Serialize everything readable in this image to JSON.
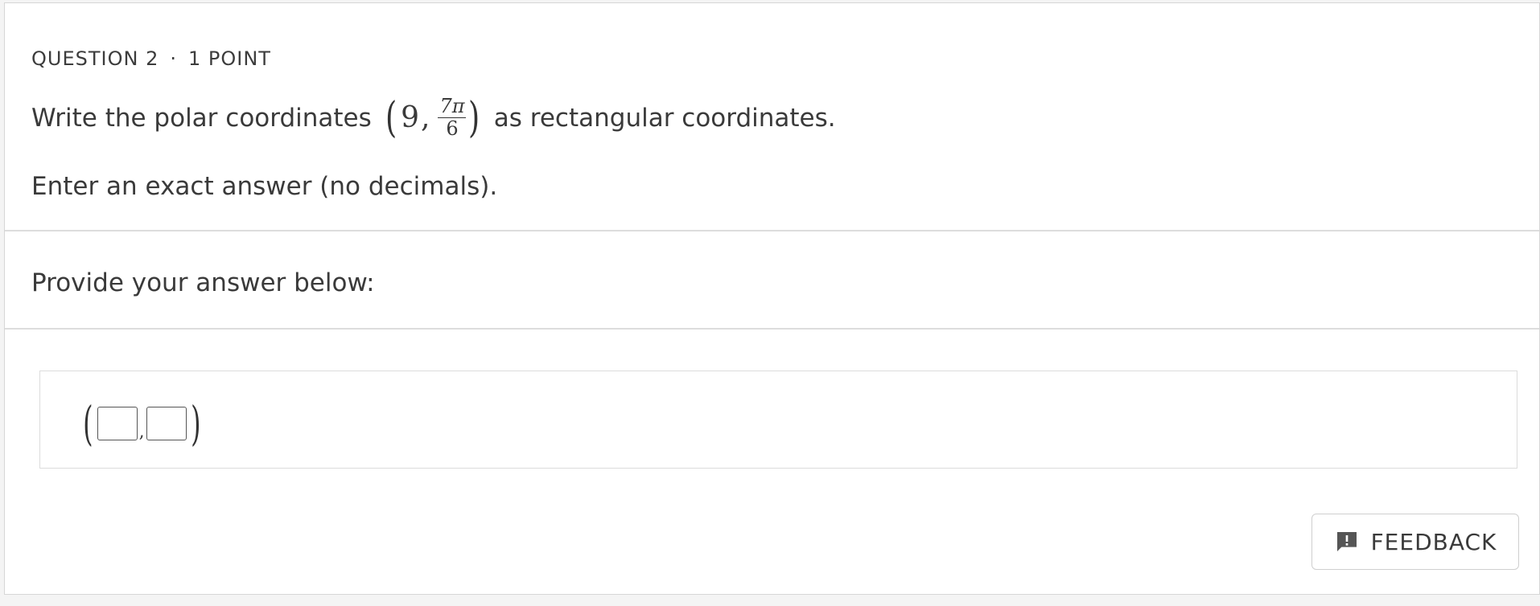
{
  "question": {
    "header_number": "QUESTION 2",
    "header_separator": "·",
    "header_points": "1 POINT",
    "text_before": "Write the polar coordinates",
    "math": {
      "open_paren": "(",
      "r": "9",
      "comma": ",",
      "theta_numerator": "7π",
      "theta_denominator": "6",
      "close_paren": ")"
    },
    "text_after": "as rectangular coordinates.",
    "note": "Enter an exact answer (no decimals)."
  },
  "answer": {
    "prompt": "Provide your answer below:",
    "template": {
      "open_paren": "(",
      "separator": ",",
      "close_paren": ")",
      "x_value": "",
      "y_value": ""
    }
  },
  "feedback_button": {
    "label": "FEEDBACK",
    "icon": "feedback-icon"
  },
  "colors": {
    "text": "#3a3a3a",
    "border": "#dddddd",
    "background": "#ffffff"
  }
}
